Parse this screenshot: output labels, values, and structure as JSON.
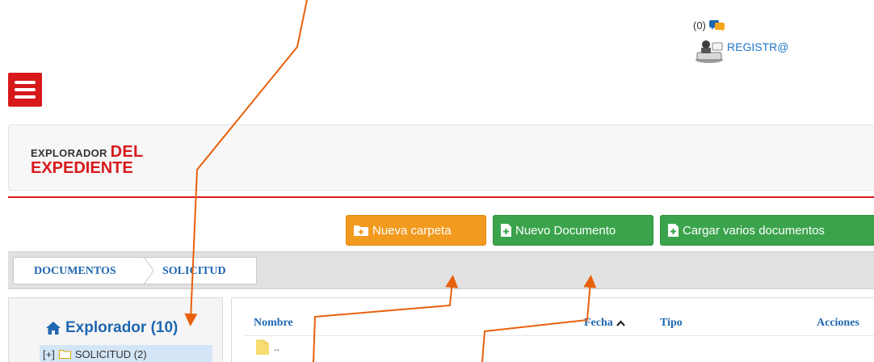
{
  "header": {
    "notification_count": "(0)",
    "chat_icon": "chat-bubbles-icon",
    "user_icon": "stamp-user-icon",
    "username": "REGISTR@"
  },
  "menu": {
    "icon": "hamburger-menu-icon"
  },
  "page_title": {
    "prefix": "EXPLORADOR",
    "highlight_line1": "DEL",
    "highlight_line2": "EXPEDIENTE"
  },
  "toolbar": {
    "new_folder_label": "Nueva carpeta",
    "new_document_label": "Nuevo Documento",
    "upload_multiple_label": "Cargar varios documentos"
  },
  "breadcrumb": {
    "items": [
      "DOCUMENTOS",
      "SOLICITUD"
    ]
  },
  "explorer": {
    "title": "Explorador (10)",
    "tree": [
      {
        "toggle": "[+]",
        "label": "SOLICITUD (2)"
      }
    ]
  },
  "file_table": {
    "columns": [
      "Nombre",
      "Fecha",
      "Tipo",
      "Acciones"
    ],
    "sort_indicator": "^",
    "rows": [
      {
        "name": ".."
      }
    ]
  },
  "colors": {
    "brand_red": "#d7191c",
    "link_blue": "#1f67b1",
    "button_orange": "#f29a1e",
    "button_green": "#3aa34b",
    "annotation_orange": "#e8600c"
  }
}
